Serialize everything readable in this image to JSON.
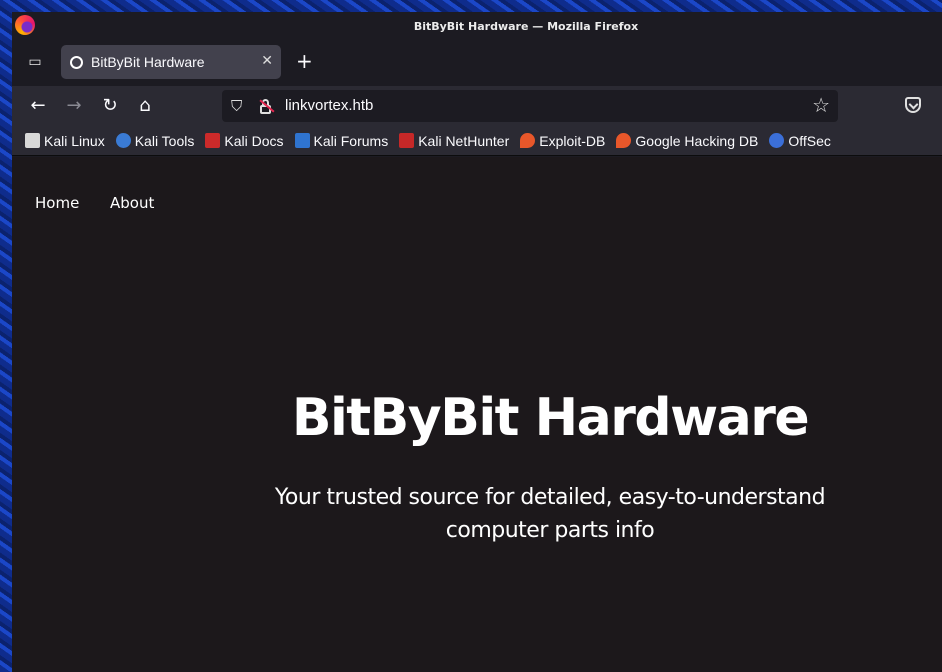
{
  "window": {
    "title": "BitByBit Hardware — Mozilla Firefox"
  },
  "tabs": [
    {
      "title": "BitByBit Hardware",
      "favicon": "circle-icon"
    }
  ],
  "urlbar": {
    "url": "linkvortex.htb"
  },
  "bookmarks": [
    {
      "label": "Kali Linux",
      "icon": "kali-dragon-icon",
      "color": "#d8d8d8"
    },
    {
      "label": "Kali Tools",
      "icon": "kali-tools-icon",
      "color": "#3a7bd5"
    },
    {
      "label": "Kali Docs",
      "icon": "kali-docs-icon",
      "color": "#cc2a2a"
    },
    {
      "label": "Kali Forums",
      "icon": "kali-forums-icon",
      "color": "#2f74d0"
    },
    {
      "label": "Kali NetHunter",
      "icon": "kali-nethunter-icon",
      "color": "#c62828"
    },
    {
      "label": "Exploit-DB",
      "icon": "exploit-db-icon",
      "color": "#e8572a"
    },
    {
      "label": "Google Hacking DB",
      "icon": "ghdb-icon",
      "color": "#e8572a"
    },
    {
      "label": "OffSec",
      "icon": "offsec-icon",
      "color": "#3b6fd8"
    }
  ],
  "page": {
    "nav": {
      "home": "Home",
      "about": "About"
    },
    "hero": {
      "title": "BitByBit Hardware",
      "subtitle_line1": "Your trusted source for detailed, easy-to-understand",
      "subtitle_line2": "computer parts info"
    }
  },
  "colors": {
    "page_bg": "#1c181b",
    "toolbar_bg": "#2b2a33",
    "tab_active_bg": "#42414d",
    "text": "#ffffff"
  }
}
